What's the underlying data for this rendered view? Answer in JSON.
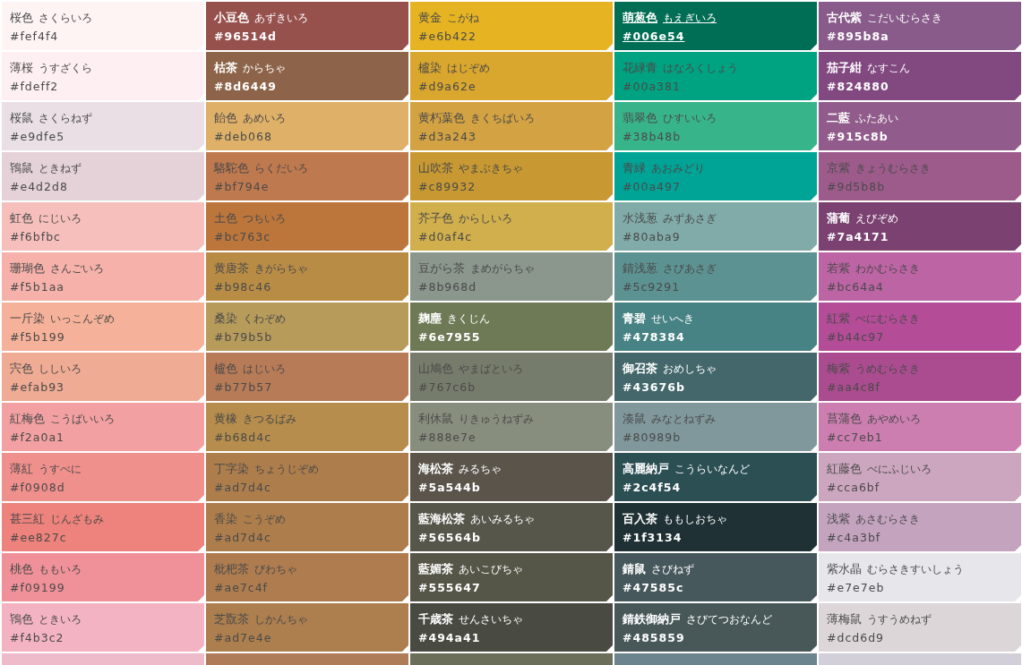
{
  "swatches": [
    {
      "name": "桜色",
      "reading": "さくらいろ",
      "hex": "#fef4f4",
      "color": "#fef4f4",
      "light_label": false,
      "hovered": false
    },
    {
      "name": "小豆色",
      "reading": "あずきいろ",
      "hex": "#96514d",
      "color": "#96514d",
      "light_label": true,
      "hovered": false
    },
    {
      "name": "黄金",
      "reading": "こがね",
      "hex": "#e6b422",
      "color": "#e6b422",
      "light_label": false,
      "hovered": false
    },
    {
      "name": "萌葱色",
      "reading": "もえぎいろ",
      "hex": "#006e54",
      "color": "#006e54",
      "light_label": true,
      "hovered": true
    },
    {
      "name": "古代紫",
      "reading": "こだいむらさき",
      "hex": "#895b8a",
      "color": "#895b8a",
      "light_label": true,
      "hovered": false
    },
    {
      "name": "薄桜",
      "reading": "うすざくら",
      "hex": "#fdeff2",
      "color": "#fdeff2",
      "light_label": false,
      "hovered": false
    },
    {
      "name": "枯茶",
      "reading": "からちゃ",
      "hex": "#8d6449",
      "color": "#8d6449",
      "light_label": true,
      "hovered": false
    },
    {
      "name": "櫨染",
      "reading": "はじぞめ",
      "hex": "#d9a62e",
      "color": "#d9a62e",
      "light_label": false,
      "hovered": false
    },
    {
      "name": "花緑青",
      "reading": "はなろくしょう",
      "hex": "#00a381",
      "color": "#00a381",
      "light_label": false,
      "hovered": false
    },
    {
      "name": "茄子紺",
      "reading": "なすこん",
      "hex": "#824880",
      "color": "#824880",
      "light_label": true,
      "hovered": false
    },
    {
      "name": "桜鼠",
      "reading": "さくらねず",
      "hex": "#e9dfe5",
      "color": "#e9dfe5",
      "light_label": false,
      "hovered": false
    },
    {
      "name": "飴色",
      "reading": "あめいろ",
      "hex": "#deb068",
      "color": "#deb068",
      "light_label": false,
      "hovered": false
    },
    {
      "name": "黄朽葉色",
      "reading": "きくちばいろ",
      "hex": "#d3a243",
      "color": "#d3a243",
      "light_label": false,
      "hovered": false
    },
    {
      "name": "翡翠色",
      "reading": "ひすいいろ",
      "hex": "#38b48b",
      "color": "#38b48b",
      "light_label": false,
      "hovered": false
    },
    {
      "name": "二藍",
      "reading": "ふたあい",
      "hex": "#915c8b",
      "color": "#915c8b",
      "light_label": true,
      "hovered": false
    },
    {
      "name": "鴇鼠",
      "reading": "ときねず",
      "hex": "#e4d2d8",
      "color": "#e4d2d8",
      "light_label": false,
      "hovered": false
    },
    {
      "name": "駱駝色",
      "reading": "らくだいろ",
      "hex": "#bf794e",
      "color": "#bf794e",
      "light_label": false,
      "hovered": false
    },
    {
      "name": "山吹茶",
      "reading": "やまぶきちゃ",
      "hex": "#c89932",
      "color": "#c89932",
      "light_label": false,
      "hovered": false
    },
    {
      "name": "青緑",
      "reading": "あおみどり",
      "hex": "#00a497",
      "color": "#00a497",
      "light_label": false,
      "hovered": false
    },
    {
      "name": "京紫",
      "reading": "きょうむらさき",
      "hex": "#9d5b8b",
      "color": "#9d5b8b",
      "light_label": false,
      "hovered": false
    },
    {
      "name": "虹色",
      "reading": "にじいろ",
      "hex": "#f6bfbc",
      "color": "#f6bfbc",
      "light_label": false,
      "hovered": false
    },
    {
      "name": "土色",
      "reading": "つちいろ",
      "hex": "#bc763c",
      "color": "#bc763c",
      "light_label": false,
      "hovered": false
    },
    {
      "name": "芥子色",
      "reading": "からしいろ",
      "hex": "#d0af4c",
      "color": "#d0af4c",
      "light_label": false,
      "hovered": false
    },
    {
      "name": "水浅葱",
      "reading": "みずあさぎ",
      "hex": "#80aba9",
      "color": "#80aba9",
      "light_label": false,
      "hovered": false
    },
    {
      "name": "蒲葡",
      "reading": "えびぞめ",
      "hex": "#7a4171",
      "color": "#7a4171",
      "light_label": true,
      "hovered": false
    },
    {
      "name": "珊瑚色",
      "reading": "さんごいろ",
      "hex": "#f5b1aa",
      "color": "#f5b1aa",
      "light_label": false,
      "hovered": false
    },
    {
      "name": "黄唐茶",
      "reading": "きがらちゃ",
      "hex": "#b98c46",
      "color": "#b98c46",
      "light_label": false,
      "hovered": false
    },
    {
      "name": "豆がら茶",
      "reading": "まめがらちゃ",
      "hex": "#8b968d",
      "color": "#8b968d",
      "light_label": false,
      "hovered": false
    },
    {
      "name": "錆浅葱",
      "reading": "さびあさぎ",
      "hex": "#5c9291",
      "color": "#5c9291",
      "light_label": false,
      "hovered": false
    },
    {
      "name": "若紫",
      "reading": "わかむらさき",
      "hex": "#bc64a4",
      "color": "#bc64a4",
      "light_label": false,
      "hovered": false
    },
    {
      "name": "一斤染",
      "reading": "いっこんぞめ",
      "hex": "#f5b199",
      "color": "#f5b199",
      "light_label": false,
      "hovered": false
    },
    {
      "name": "桑染",
      "reading": "くわぞめ",
      "hex": "#b79b5b",
      "color": "#b79b5b",
      "light_label": false,
      "hovered": false
    },
    {
      "name": "麹塵",
      "reading": "きくじん",
      "hex": "#6e7955",
      "color": "#6e7955",
      "light_label": true,
      "hovered": false
    },
    {
      "name": "青碧",
      "reading": "せいへき",
      "hex": "#478384",
      "color": "#478384",
      "light_label": true,
      "hovered": false
    },
    {
      "name": "紅紫",
      "reading": "べにむらさき",
      "hex": "#b44c97",
      "color": "#b44c97",
      "light_label": false,
      "hovered": false
    },
    {
      "name": "宍色",
      "reading": "ししいろ",
      "hex": "#efab93",
      "color": "#efab93",
      "light_label": false,
      "hovered": false
    },
    {
      "name": "櫨色",
      "reading": "はじいろ",
      "hex": "#b77b57",
      "color": "#b77b57",
      "light_label": false,
      "hovered": false
    },
    {
      "name": "山鳩色",
      "reading": "やまばといろ",
      "hex": "#767c6b",
      "color": "#767c6b",
      "light_label": false,
      "hovered": false
    },
    {
      "name": "御召茶",
      "reading": "おめしちゃ",
      "hex": "#43676b",
      "color": "#43676b",
      "light_label": true,
      "hovered": false
    },
    {
      "name": "梅紫",
      "reading": "うめむらさき",
      "hex": "#aa4c8f",
      "color": "#aa4c8f",
      "light_label": false,
      "hovered": false
    },
    {
      "name": "紅梅色",
      "reading": "こうばいいろ",
      "hex": "#f2a0a1",
      "color": "#f2a0a1",
      "light_label": false,
      "hovered": false
    },
    {
      "name": "黄橡",
      "reading": "きつるばみ",
      "hex": "#b68d4c",
      "color": "#b68d4c",
      "light_label": false,
      "hovered": false
    },
    {
      "name": "利休鼠",
      "reading": "りきゅうねずみ",
      "hex": "#888e7e",
      "color": "#888e7e",
      "light_label": false,
      "hovered": false
    },
    {
      "name": "湊鼠",
      "reading": "みなとねずみ",
      "hex": "#80989b",
      "color": "#80989b",
      "light_label": false,
      "hovered": false
    },
    {
      "name": "菖蒲色",
      "reading": "あやめいろ",
      "hex": "#cc7eb1",
      "color": "#cc7eb1",
      "light_label": false,
      "hovered": false
    },
    {
      "name": "薄紅",
      "reading": "うすべに",
      "hex": "#f0908d",
      "color": "#f0908d",
      "light_label": false,
      "hovered": false
    },
    {
      "name": "丁字染",
      "reading": "ちょうじぞめ",
      "hex": "#ad7d4c",
      "color": "#ad7d4c",
      "light_label": false,
      "hovered": false
    },
    {
      "name": "海松茶",
      "reading": "みるちゃ",
      "hex": "#5a544b",
      "color": "#5a544b",
      "light_label": true,
      "hovered": false
    },
    {
      "name": "高麗納戸",
      "reading": "こうらいなんど",
      "hex": "#2c4f54",
      "color": "#2c4f54",
      "light_label": true,
      "hovered": false
    },
    {
      "name": "紅藤色",
      "reading": "べにふじいろ",
      "hex": "#cca6bf",
      "color": "#cca6bf",
      "light_label": false,
      "hovered": false
    },
    {
      "name": "甚三紅",
      "reading": "じんざもみ",
      "hex": "#ee827c",
      "color": "#ee827c",
      "light_label": false,
      "hovered": false
    },
    {
      "name": "香染",
      "reading": "こうぞめ",
      "hex": "#ad7d4c",
      "color": "#ad7d4c",
      "light_label": false,
      "hovered": false
    },
    {
      "name": "藍海松茶",
      "reading": "あいみるちゃ",
      "hex": "#56564b",
      "color": "#56564b",
      "light_label": true,
      "hovered": false
    },
    {
      "name": "百入茶",
      "reading": "ももしおちゃ",
      "hex": "#1f3134",
      "color": "#1f3134",
      "light_label": true,
      "hovered": false
    },
    {
      "name": "浅紫",
      "reading": "あさむらさき",
      "hex": "#c4a3bf",
      "color": "#c4a3bf",
      "light_label": false,
      "hovered": false
    },
    {
      "name": "桃色",
      "reading": "ももいろ",
      "hex": "#f09199",
      "color": "#f09199",
      "light_label": false,
      "hovered": false
    },
    {
      "name": "枇杷茶",
      "reading": "びわちゃ",
      "hex": "#ae7c4f",
      "color": "#ae7c4f",
      "light_label": false,
      "hovered": false
    },
    {
      "name": "藍媚茶",
      "reading": "あいこびちゃ",
      "hex": "#555647",
      "color": "#555647",
      "light_label": true,
      "hovered": false
    },
    {
      "name": "錆鼠",
      "reading": "さびねず",
      "hex": "#47585c",
      "color": "#47585c",
      "light_label": true,
      "hovered": false
    },
    {
      "name": "紫水晶",
      "reading": "むらさきすいしょう",
      "hex": "#e7e7eb",
      "color": "#e7e7eb",
      "light_label": false,
      "hovered": false
    },
    {
      "name": "鴇色",
      "reading": "ときいろ",
      "hex": "#f4b3c2",
      "color": "#f4b3c2",
      "light_label": false,
      "hovered": false
    },
    {
      "name": "芝翫茶",
      "reading": "しかんちゃ",
      "hex": "#ad7e4e",
      "color": "#ad7e4e",
      "light_label": false,
      "hovered": false
    },
    {
      "name": "千歳茶",
      "reading": "せんさいちゃ",
      "hex": "#494a41",
      "color": "#494a41",
      "light_label": true,
      "hovered": false
    },
    {
      "name": "錆鉄御納戸",
      "reading": "さびてつおなんど",
      "hex": "#485859",
      "color": "#485859",
      "light_label": true,
      "hovered": false
    },
    {
      "name": "薄梅鼠",
      "reading": "うすうめねず",
      "hex": "#dcd6d9",
      "color": "#dcd6d9",
      "light_label": false,
      "hovered": false
    },
    {
      "color": "#eebbcb"
    },
    {
      "color": "#ae7c58"
    },
    {
      "color": "#6b6f59"
    },
    {
      "color": "#6c848d"
    },
    {
      "color": "#d3cfd9"
    }
  ]
}
